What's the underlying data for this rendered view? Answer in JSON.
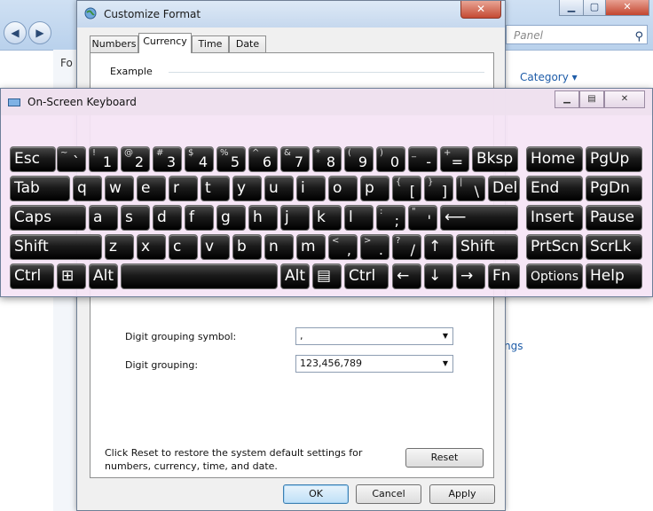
{
  "background_window": {
    "search_placeholder": "Panel",
    "category_label": "Category ▾",
    "link_fragment": "ngs",
    "left_fragment": "Fo"
  },
  "dialog": {
    "title": "Customize Format",
    "tabs": [
      {
        "label": "Numbers",
        "active": false
      },
      {
        "label": "Currency",
        "active": true
      },
      {
        "label": "Time",
        "active": false
      },
      {
        "label": "Date",
        "active": false
      }
    ],
    "example_label": "Example",
    "digit_grouping_symbol_label": "Digit grouping symbol:",
    "digit_grouping_symbol_value": ",",
    "digit_grouping_label": "Digit grouping:",
    "digit_grouping_value": "123,456,789",
    "reset_note": "Click Reset to restore the system default settings for numbers, currency, time, and date.",
    "reset_button": "Reset",
    "ok_button": "OK",
    "cancel_button": "Cancel",
    "apply_button": "Apply"
  },
  "osk": {
    "title": "On-Screen Keyboard",
    "rows": [
      [
        {
          "main": "Esc"
        },
        {
          "shift": "~",
          "base": "`"
        },
        {
          "shift": "!",
          "base": "1"
        },
        {
          "shift": "@",
          "base": "2"
        },
        {
          "shift": "#",
          "base": "3"
        },
        {
          "shift": "$",
          "base": "4"
        },
        {
          "shift": "%",
          "base": "5"
        },
        {
          "shift": "^",
          "base": "6"
        },
        {
          "shift": "&",
          "base": "7"
        },
        {
          "shift": "*",
          "base": "8"
        },
        {
          "shift": "(",
          "base": "9"
        },
        {
          "shift": ")",
          "base": "0"
        },
        {
          "shift": "_",
          "base": "-"
        },
        {
          "shift": "+",
          "base": "="
        },
        {
          "main": "Bksp"
        },
        {
          "main": "Home"
        },
        {
          "main": "PgUp"
        }
      ],
      [
        {
          "main": "Tab"
        },
        {
          "main": "q"
        },
        {
          "main": "w"
        },
        {
          "main": "e"
        },
        {
          "main": "r"
        },
        {
          "main": "t"
        },
        {
          "main": "y"
        },
        {
          "main": "u"
        },
        {
          "main": "i"
        },
        {
          "main": "o"
        },
        {
          "main": "p"
        },
        {
          "shift": "{",
          "base": "["
        },
        {
          "shift": "}",
          "base": "]"
        },
        {
          "shift": "|",
          "base": "\\"
        },
        {
          "main": "Del"
        },
        {
          "main": "End"
        },
        {
          "main": "PgDn"
        }
      ],
      [
        {
          "main": "Caps"
        },
        {
          "main": "a"
        },
        {
          "main": "s"
        },
        {
          "main": "d"
        },
        {
          "main": "f"
        },
        {
          "main": "g"
        },
        {
          "main": "h"
        },
        {
          "main": "j"
        },
        {
          "main": "k"
        },
        {
          "main": "l"
        },
        {
          "shift": ":",
          "base": ";"
        },
        {
          "shift": "\"",
          "base": "'"
        },
        {
          "main": "⟵"
        },
        {
          "main": "Insert"
        },
        {
          "main": "Pause"
        }
      ],
      [
        {
          "main": "Shift"
        },
        {
          "main": "z"
        },
        {
          "main": "x"
        },
        {
          "main": "c"
        },
        {
          "main": "v"
        },
        {
          "main": "b"
        },
        {
          "main": "n"
        },
        {
          "main": "m"
        },
        {
          "shift": "<",
          "base": ","
        },
        {
          "shift": ">",
          "base": "."
        },
        {
          "shift": "?",
          "base": "/"
        },
        {
          "main": "↑"
        },
        {
          "main": "Shift"
        },
        {
          "main": "PrtScn"
        },
        {
          "main": "ScrLk"
        }
      ],
      [
        {
          "main": "Ctrl"
        },
        {
          "main": "⊞"
        },
        {
          "main": "Alt"
        },
        {
          "main": ""
        },
        {
          "main": "Alt"
        },
        {
          "main": "▤"
        },
        {
          "main": "Ctrl"
        },
        {
          "main": "←"
        },
        {
          "main": "↓"
        },
        {
          "main": "→"
        },
        {
          "main": "Fn"
        },
        {
          "main": "Options"
        },
        {
          "main": "Help"
        }
      ]
    ]
  }
}
